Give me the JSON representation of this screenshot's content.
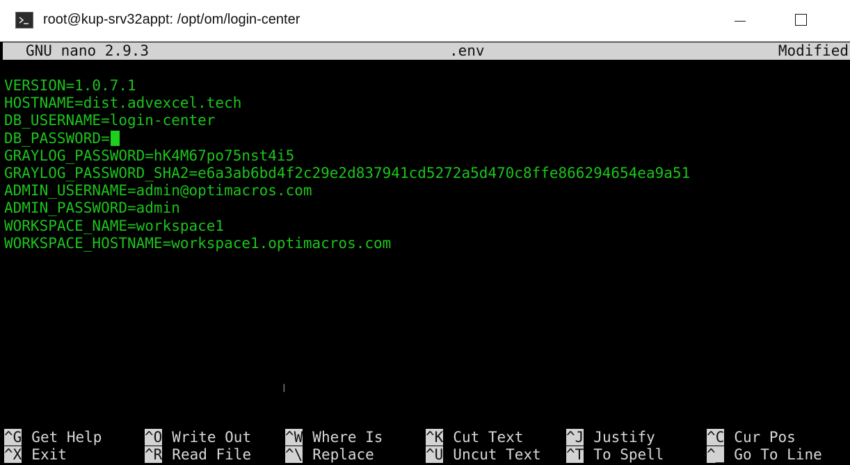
{
  "window": {
    "title": "root@kup-srv32appt: /opt/om/login-center",
    "icons": {
      "app": "terminal-icon",
      "minimize": "minimize-icon",
      "maximize": "maximize-icon"
    }
  },
  "nano": {
    "version": "GNU nano 2.9.3",
    "filename": ".env",
    "status": "Modified"
  },
  "file_lines": [
    "VERSION=1.0.7.1",
    "HOSTNAME=dist.advexcel.tech",
    "DB_USERNAME=login-center",
    "DB_PASSWORD=",
    "GRAYLOG_PASSWORD=hK4M67po75nst4i5",
    "GRAYLOG_PASSWORD_SHA2=e6a3ab6bd4f2c29e2d837941cd5272a5d470c8ffe866294654ea9a51",
    "ADMIN_USERNAME=admin@optimacros.com",
    "ADMIN_PASSWORD=admin",
    "WORKSPACE_NAME=workspace1",
    "WORKSPACE_HOSTNAME=workspace1.optimacros.com"
  ],
  "shortcuts": [
    {
      "key": "^G",
      "label": "Get Help"
    },
    {
      "key": "^O",
      "label": "Write Out"
    },
    {
      "key": "^W",
      "label": "Where Is"
    },
    {
      "key": "^K",
      "label": "Cut Text"
    },
    {
      "key": "^J",
      "label": "Justify"
    },
    {
      "key": "^C",
      "label": "Cur Pos"
    },
    {
      "key": "^X",
      "label": "Exit"
    },
    {
      "key": "^R",
      "label": "Read File"
    },
    {
      "key": "^\\",
      "label": "Replace"
    },
    {
      "key": "^U",
      "label": "Uncut Text"
    },
    {
      "key": "^T",
      "label": "To Spell"
    },
    {
      "key": "^_",
      "label": "Go To Line"
    }
  ],
  "colors": {
    "text_green": "#1cc41c",
    "bar_gray": "#d3d3d3",
    "background": "#000000"
  }
}
